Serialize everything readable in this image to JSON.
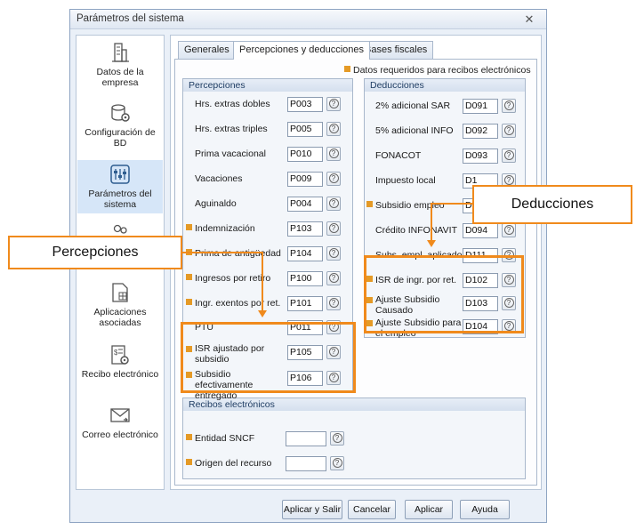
{
  "window": {
    "title": "Parámetros del sistema",
    "close_glyph": "✕"
  },
  "sidebar": {
    "items": [
      {
        "label": "Datos de la empresa",
        "icon": "building-icon"
      },
      {
        "label": "Configuración de BD",
        "icon": "database-gear-icon"
      },
      {
        "label": "Parámetros del sistema",
        "icon": "sliders-icon",
        "selected": true
      },
      {
        "label": "",
        "icon": "users-icon"
      },
      {
        "label": "Aplicaciones asociadas",
        "icon": "spreadsheet-icon"
      },
      {
        "label": "Recibo electrónico",
        "icon": "receipt-gear-icon"
      },
      {
        "label": "Correo electrónico",
        "icon": "mail-icon"
      }
    ]
  },
  "tabs": [
    {
      "label": "Generales",
      "active": false
    },
    {
      "label": "Percepciones y deducciones",
      "active": true
    },
    {
      "label": "Bases fiscales",
      "active": false
    }
  ],
  "required_note": "Datos requeridos para recibos electrónicos",
  "percepciones": {
    "title": "Percepciones",
    "rows": [
      {
        "label": "Hrs. extras dobles",
        "code": "P003",
        "required": false
      },
      {
        "label": "Hrs. extras triples",
        "code": "P005",
        "required": false
      },
      {
        "label": "Prima vacacional",
        "code": "P010",
        "required": false
      },
      {
        "label": "Vacaciones",
        "code": "P009",
        "required": false
      },
      {
        "label": "Aguinaldo",
        "code": "P004",
        "required": false
      },
      {
        "label": "Indemnización",
        "code": "P103",
        "required": true
      },
      {
        "label": "Prima de antigüedad",
        "code": "P104",
        "required": true
      },
      {
        "label": "Ingresos por retiro",
        "code": "P100",
        "required": true
      },
      {
        "label": "Ingr. exentos por ret.",
        "code": "P101",
        "required": true
      },
      {
        "label": "PTU",
        "code": "P011",
        "required": false
      },
      {
        "label": "ISR ajustado por subsidio",
        "code": "P105",
        "required": true
      },
      {
        "label": "Subsidio efectivamente entregado",
        "code": "P106",
        "required": true
      }
    ]
  },
  "deducciones": {
    "title": "Deducciones",
    "rows": [
      {
        "label": "2% adicional SAR",
        "code": "D091",
        "required": false
      },
      {
        "label": "5% adicional INFO",
        "code": "D092",
        "required": false
      },
      {
        "label": "FONACOT",
        "code": "D093",
        "required": false
      },
      {
        "label": "Impuesto local",
        "code": "D1",
        "required": false
      },
      {
        "label": "Subsidio empleo",
        "code": "D1",
        "required": true
      },
      {
        "label": "Crédito INFONAVIT",
        "code": "D094",
        "required": false
      },
      {
        "label": "Subs. empl. aplicado",
        "code": "D111",
        "required": false
      },
      {
        "label": "ISR de ingr. por ret.",
        "code": "D102",
        "required": true
      },
      {
        "label": "Ajuste Subsidio Causado",
        "code": "D103",
        "required": true
      },
      {
        "label": "Ajuste Subsidio para el empleo",
        "code": "D104",
        "required": true
      }
    ]
  },
  "recibos": {
    "title": "Recibos electrónicos",
    "rows": [
      {
        "label": "Entidad SNCF",
        "value": "",
        "required": true
      },
      {
        "label": "Origen del recurso",
        "value": "",
        "required": true
      }
    ]
  },
  "buttons": {
    "apply_exit": "Aplicar y Salir",
    "cancel": "Cancelar",
    "apply": "Aplicar",
    "help": "Ayuda"
  },
  "callouts": {
    "percepciones": "Percepciones",
    "deducciones": "Deducciones"
  },
  "help_glyph": "?",
  "colors": {
    "highlight": "#f08a1c",
    "required_marker": "#e59a26",
    "selected": "#d6e6f8"
  }
}
